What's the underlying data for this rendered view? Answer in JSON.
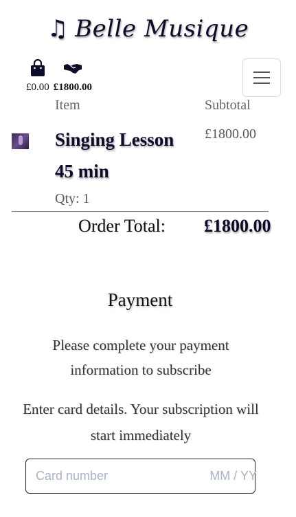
{
  "brand": {
    "icon": "music-note-icon",
    "name": "Belle Musique"
  },
  "nav": {
    "bag_icon": "shopping-bag-icon",
    "bag_total": "£0.00",
    "subscription_icon": "handshake-icon",
    "subscription_total": "£1800.00",
    "menu_icon": "hamburger-menu-icon"
  },
  "cart": {
    "header_item": "Item",
    "header_subtotal": "Subtotal",
    "items": [
      {
        "name": "Singing Lesson 45 min",
        "qty": "Qty: 1",
        "subtotal": "£1800.00"
      }
    ],
    "total_label": "Order Total:",
    "total_value": "£1800.00"
  },
  "payment": {
    "title": "Payment",
    "instructions": "Please complete your payment information to subscribe",
    "card_message": "Enter card details. Your subscription will start immediately",
    "card_number_placeholder": "Card number",
    "card_expiry_placeholder": "MM / YY"
  },
  "colors": {
    "brand_dark": "#0c0c2a",
    "placeholder": "#a8b3c4"
  }
}
